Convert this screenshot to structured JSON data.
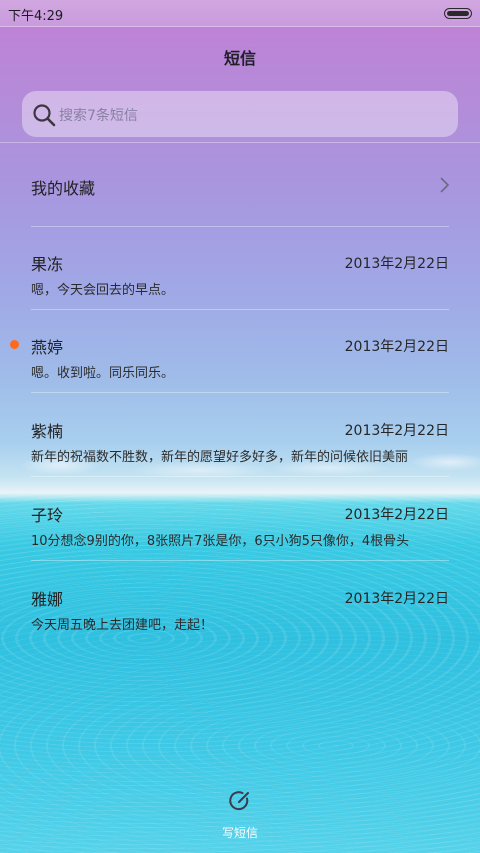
{
  "status_bar": {
    "time": "下午4:29",
    "battery_icon": "battery-icon"
  },
  "header": {
    "title": "短信"
  },
  "search": {
    "placeholder": "搜索7条短信",
    "icon": "search-icon"
  },
  "favorites": {
    "label": "我的收藏",
    "icon": "chevron-right-icon"
  },
  "conversations": [
    {
      "name": "果冻",
      "date": "2013年2月22日",
      "preview": "嗯，今天会回去的早点。",
      "unread": false
    },
    {
      "name": "燕婷",
      "date": "2013年2月22日",
      "preview": "嗯。收到啦。同乐同乐。",
      "unread": true
    },
    {
      "name": "紫楠",
      "date": "2013年2月22日",
      "preview": "新年的祝福数不胜数，新年的愿望好多好多，新年的问候依旧美丽",
      "unread": false
    },
    {
      "name": "子玲",
      "date": "2013年2月22日",
      "preview": "10分想念9别的你，8张照片7张是你，6只小狗5只像你，4根骨头",
      "unread": false
    },
    {
      "name": "雅娜",
      "date": "2013年2月22日",
      "preview": "今天周五晚上去团建吧，走起！",
      "unread": false
    }
  ],
  "compose": {
    "label": "写短信",
    "icon": "compose-icon"
  },
  "colors": {
    "unread_dot": "#ff6a1a"
  }
}
